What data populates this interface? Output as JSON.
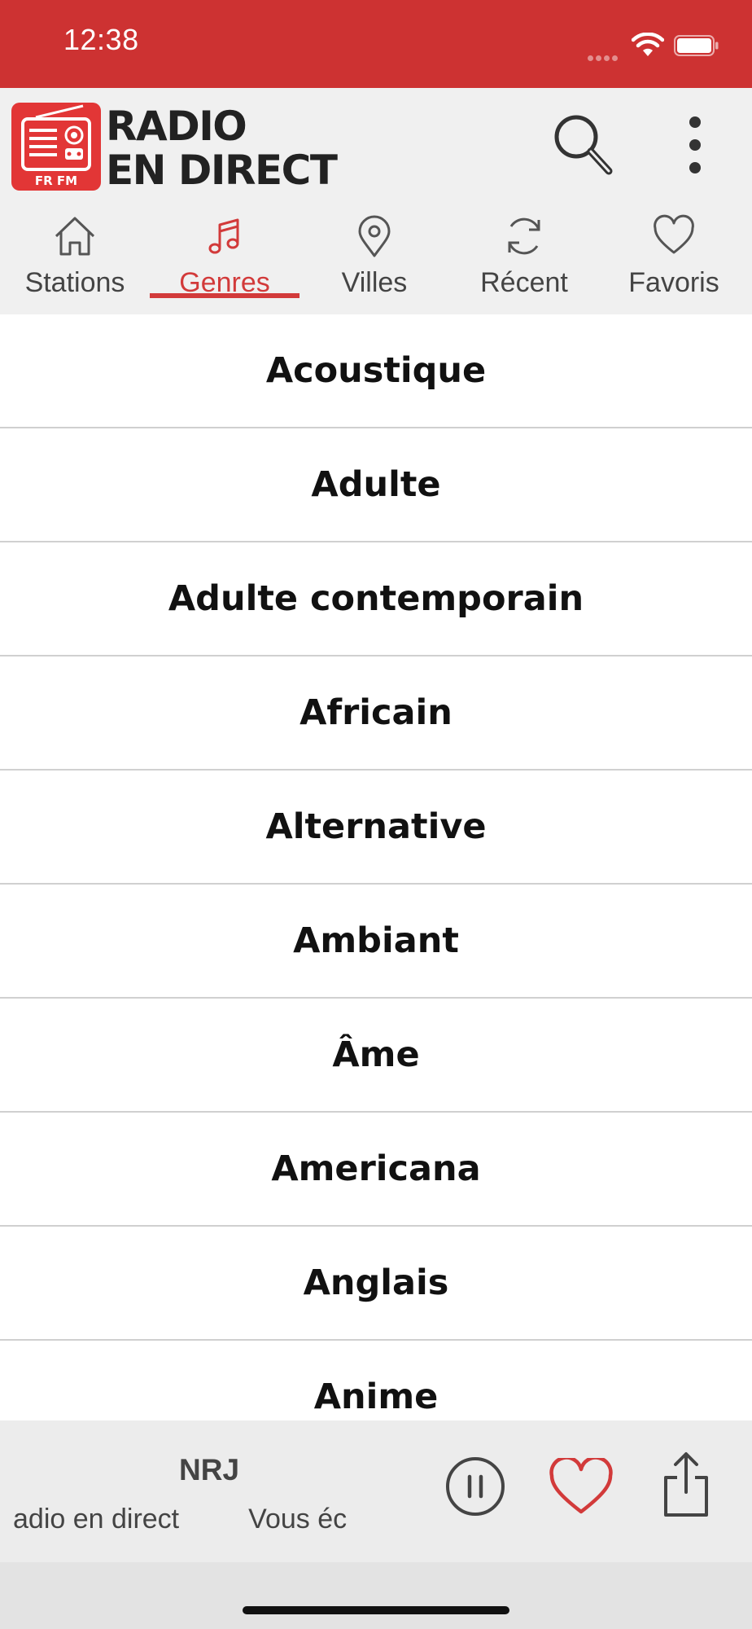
{
  "status_bar": {
    "time": "12:38",
    "icons": [
      "cellular-signal-icon",
      "wifi-icon",
      "battery-icon"
    ]
  },
  "header": {
    "logo_badge": "FR FM",
    "logo_line1": "RADIO",
    "logo_line2": "EN DIRECT",
    "icons": [
      "search-icon",
      "more-vert-icon"
    ]
  },
  "tabs": [
    {
      "label": "Stations",
      "icon": "home-icon",
      "active": false
    },
    {
      "label": "Genres",
      "icon": "music-note-icon",
      "active": true
    },
    {
      "label": "Villes",
      "icon": "location-pin-icon",
      "active": false
    },
    {
      "label": "Récent",
      "icon": "refresh-icon",
      "active": false
    },
    {
      "label": "Favoris",
      "icon": "heart-icon",
      "active": false
    }
  ],
  "genres": [
    "Acoustique",
    "Adulte",
    "Adulte contemporain",
    "Africain",
    "Alternative",
    "Ambiant",
    "Âme",
    "Americana",
    "Anglais",
    "Anime"
  ],
  "player": {
    "station": "NRJ",
    "ticker": "adio en direct         Vous éc",
    "icons": [
      "pause-icon",
      "heart-icon",
      "share-icon"
    ]
  },
  "colors": {
    "brand": "#cd3232",
    "accent": "#d23a3a",
    "header_bg": "#f0f0f0",
    "player_bg": "#ececec"
  }
}
